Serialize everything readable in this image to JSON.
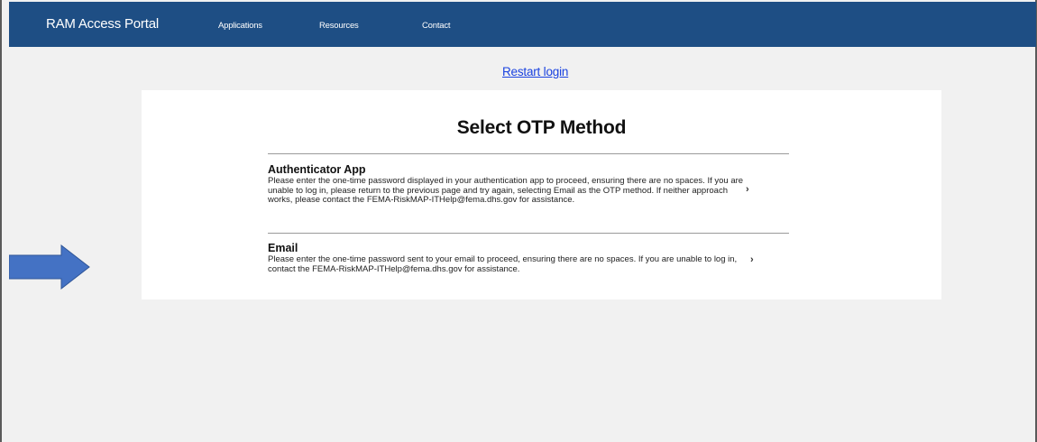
{
  "navbar": {
    "brand": "RAM Access Portal",
    "links": [
      "Applications",
      "Resources",
      "Contact"
    ]
  },
  "restart_link": "Restart login",
  "card": {
    "title": "Select OTP Method",
    "options": [
      {
        "title": "Authenticator App",
        "description": "Please enter the one-time password displayed in your authentication app to proceed, ensuring there are no spaces. If you are unable to log in, please return to the previous page and try again, selecting Email as the OTP method. If neither approach works, please contact the FEMA-RiskMAP-ITHelp@fema.dhs.gov for assistance.",
        "chevron": "›"
      },
      {
        "title": "Email",
        "description": "Please enter the one-time password sent to your email to proceed, ensuring there are no spaces. If you are unable to log in, contact the FEMA-RiskMAP-ITHelp@fema.dhs.gov for assistance.",
        "chevron": "›"
      }
    ]
  },
  "colors": {
    "navbar": "#1e4e84",
    "link": "#1b43e0",
    "arrow": "#4472c4"
  },
  "icons": {
    "annotation_arrow": "right-arrow-icon",
    "option_chevron": "chevron-right-icon"
  }
}
